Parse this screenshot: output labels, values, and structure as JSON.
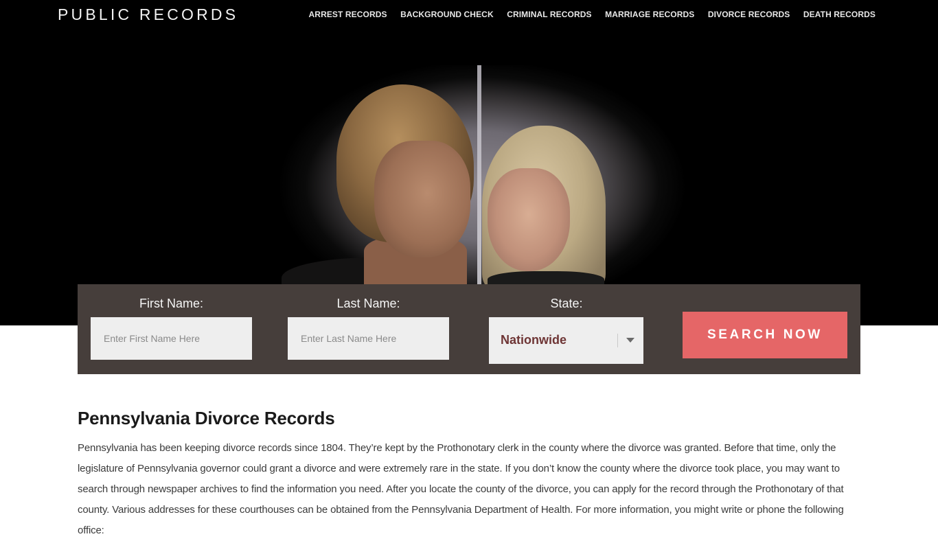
{
  "header": {
    "logo": "PUBLIC RECORDS",
    "nav": [
      {
        "label": "ARREST RECORDS"
      },
      {
        "label": "BACKGROUND CHECK"
      },
      {
        "label": "CRIMINAL RECORDS"
      },
      {
        "label": "MARRIAGE RECORDS"
      },
      {
        "label": "DIVORCE RECORDS"
      },
      {
        "label": "DEATH RECORDS"
      }
    ]
  },
  "hero": {
    "image_description": "couple-leaning-against-divided-wall"
  },
  "search": {
    "first_name_label": "First Name:",
    "first_name_placeholder": "Enter First Name Here",
    "first_name_value": "",
    "last_name_label": "Last Name:",
    "last_name_placeholder": "Enter Last Name Here",
    "last_name_value": "",
    "state_label": "State:",
    "state_selected": "Nationwide",
    "button_label": "SEARCH NOW",
    "button_color": "#e56667",
    "panel_color": "#463e3b"
  },
  "article": {
    "title": "Pennsylvania Divorce Records",
    "body": "Pennsylvania has been keeping divorce records since 1804. They’re kept by the Prothonotary clerk in the county where the divorce was granted. Before that time, only the legislature of Pennsylvania governor could grant a divorce and were extremely rare in the state. If you don’t know the county where the divorce took place, you may want to search through newspaper archives to find the information you need. After you locate the county of the divorce, you can apply for the record through the Prothonotary of that county. Various addresses for these courthouses can be obtained from the Pennsylvania Department of Health. For more information, you might write or phone the following office:"
  }
}
